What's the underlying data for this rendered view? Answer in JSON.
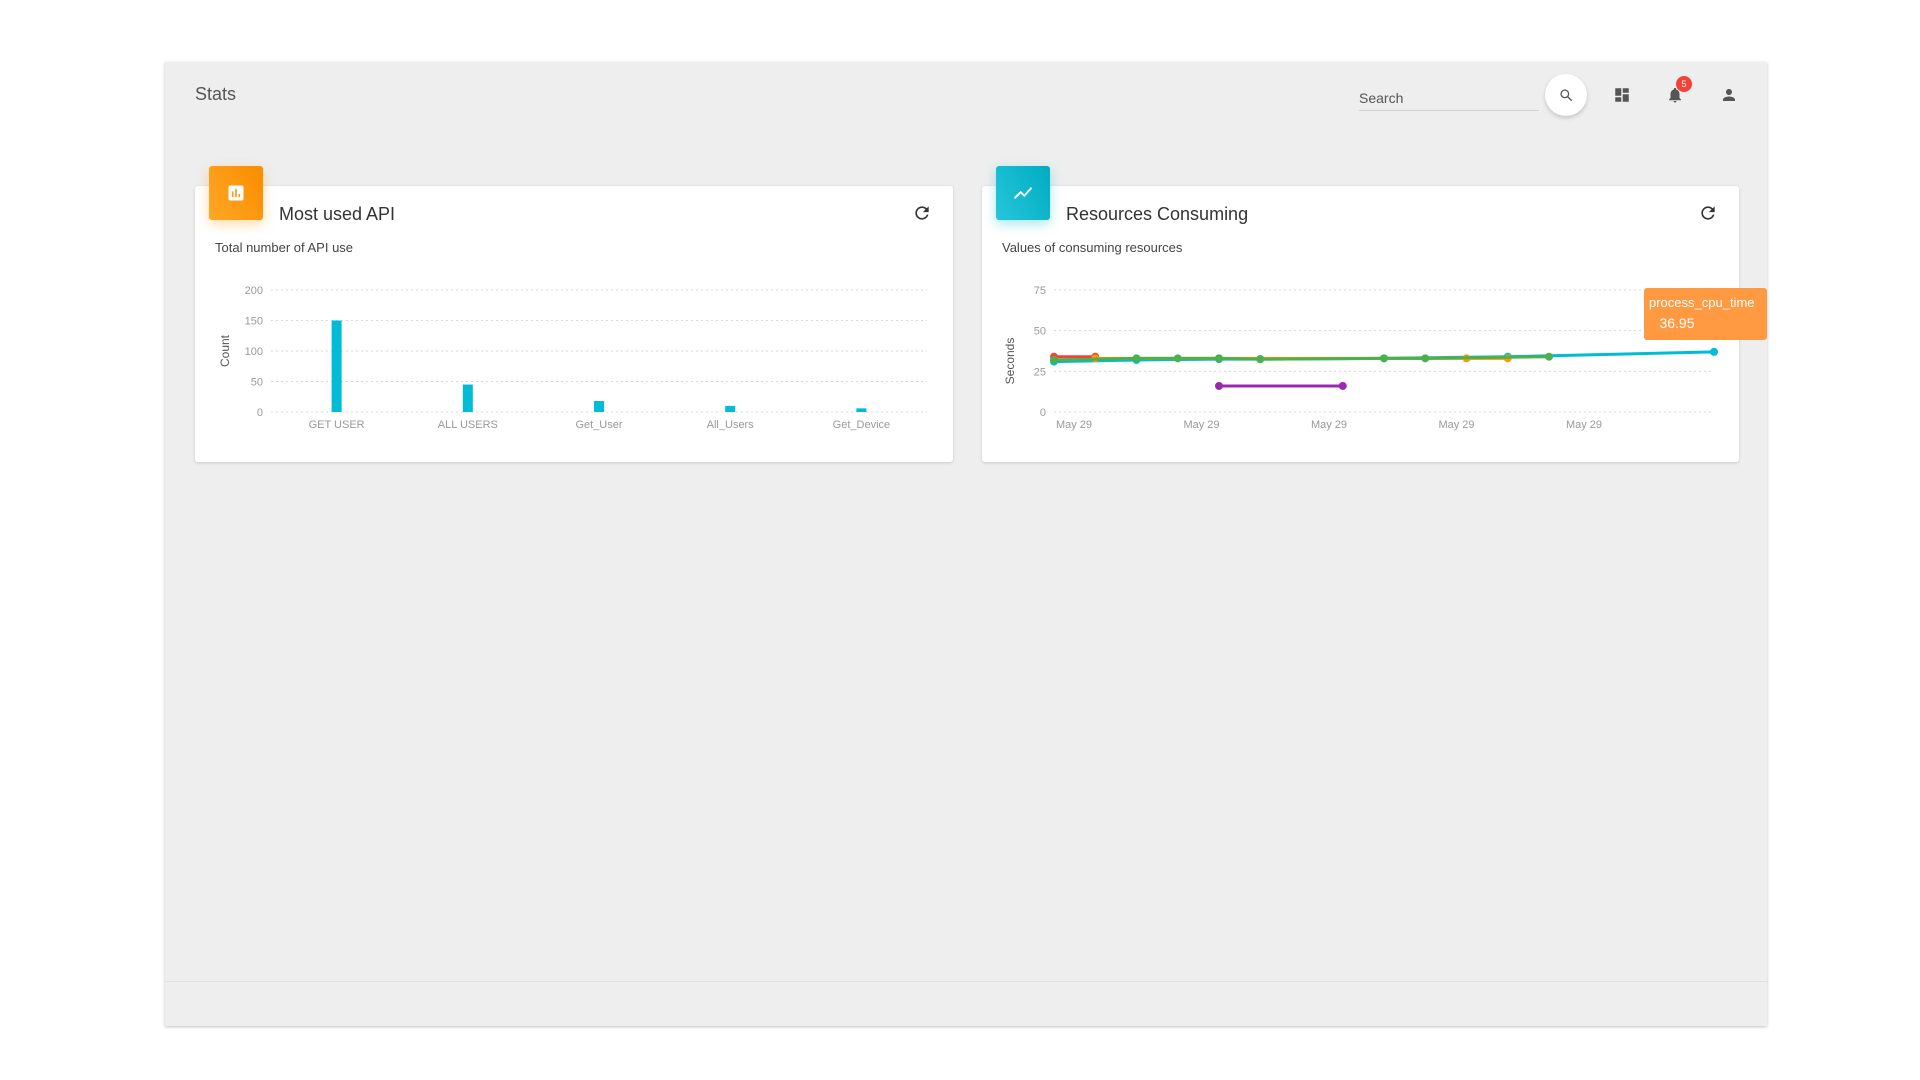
{
  "app": {
    "title": "Stats",
    "search": {
      "placeholder": "Search"
    },
    "notifications": {
      "count": "5"
    },
    "icons": {
      "search": "search-icon",
      "dashboard": "dashboard-icon",
      "notifications": "bell-icon",
      "profile": "person-icon"
    }
  },
  "cards": {
    "api": {
      "title": "Most used API",
      "subtitle": "Total number of API use",
      "icon": "bar-chart-icon",
      "accent": "#fb8c00"
    },
    "resources": {
      "title": "Resources Consuming",
      "subtitle": "Values of consuming resources",
      "icon": "trending-up-icon",
      "accent": "#00acc1"
    }
  },
  "tooltip": {
    "name": "process_cpu_time",
    "value": "36.95",
    "color": "#ff9a42"
  },
  "chart_data": [
    {
      "type": "bar",
      "categories": [
        "GET USER",
        "ALL USERS",
        "Get_User",
        "All_Users",
        "Get_Device"
      ],
      "values": [
        150,
        45,
        18,
        10,
        6
      ],
      "ylabel": "Count",
      "ylim": [
        0,
        200
      ],
      "yticks": [
        0,
        50,
        100,
        150,
        200
      ],
      "color": "#00bcd4",
      "grid": true
    },
    {
      "type": "line",
      "ylabel": "Seconds",
      "ylim": [
        0,
        75
      ],
      "yticks": [
        0,
        25,
        50,
        75
      ],
      "x_tick_labels": [
        "May 29",
        "May 29",
        "May 29",
        "May 29",
        "May 29"
      ],
      "x_domain": [
        0,
        16
      ],
      "grid": true,
      "series": [
        {
          "name": "process_cpu_time",
          "color": "#00bcd4",
          "points": [
            [
              0,
              31
            ],
            [
              2,
              32
            ],
            [
              4,
              32.5
            ],
            [
              5,
              32.5
            ],
            [
              8,
              33
            ],
            [
              11,
              34
            ],
            [
              16,
              36.95
            ]
          ]
        },
        {
          "color": "#f44336",
          "points": [
            [
              0,
              34
            ],
            [
              1,
              34
            ]
          ]
        },
        {
          "color": "#ff9800",
          "points": [
            [
              1,
              33
            ],
            [
              4,
              33
            ],
            [
              10,
              33
            ],
            [
              11,
              33
            ]
          ]
        },
        {
          "color": "#4caf50",
          "points": [
            [
              0,
              32
            ],
            [
              2,
              33
            ],
            [
              3,
              33
            ],
            [
              4,
              33
            ],
            [
              5,
              32.5
            ],
            [
              8,
              33
            ],
            [
              9,
              33
            ],
            [
              12,
              34
            ]
          ]
        },
        {
          "color": "#9c27b0",
          "points": [
            [
              4,
              16
            ],
            [
              7,
              16
            ]
          ]
        }
      ]
    }
  ]
}
